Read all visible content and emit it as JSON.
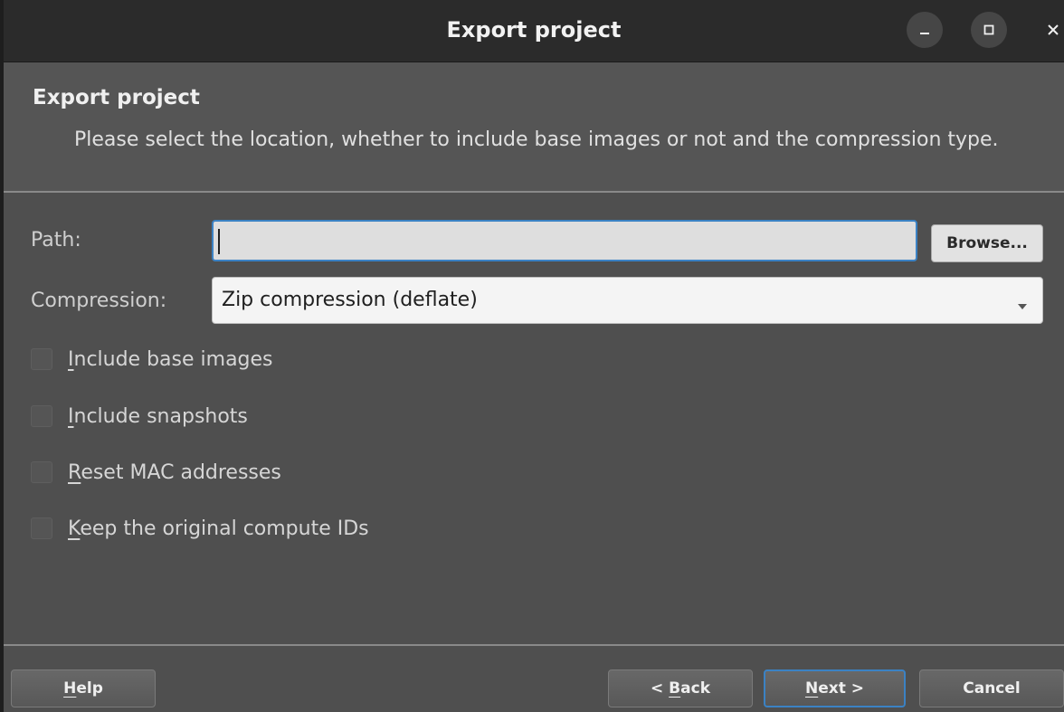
{
  "window": {
    "title": "Export project"
  },
  "header": {
    "title": "Export project",
    "subtitle": "Please select the location, whether to include base images or not and the compression type."
  },
  "form": {
    "path_label": "Path:",
    "path_value": "",
    "browse_label": "Browse...",
    "compression_label": "Compression:",
    "compression_value": "Zip compression (deflate)"
  },
  "options": [
    {
      "mnemonic": "I",
      "rest": "nclude base images",
      "checked": false
    },
    {
      "mnemonic": "I",
      "rest": "nclude snapshots",
      "checked": false
    },
    {
      "mnemonic": "R",
      "rest": "eset MAC addresses",
      "checked": false
    },
    {
      "mnemonic": "K",
      "rest": "eep the original compute IDs",
      "checked": false
    }
  ],
  "footer": {
    "help": {
      "mnemonic": "H",
      "rest": "elp"
    },
    "back": {
      "pre": "< ",
      "mnemonic": "B",
      "rest": "ack"
    },
    "next": {
      "mnemonic": "N",
      "rest": "ext >"
    },
    "cancel": "Cancel"
  },
  "colors": {
    "focus_accent": "#3b82c4",
    "window_bg": "#4f4f4f",
    "titlebar_bg": "#2b2b2b"
  },
  "icons": [
    "minimize-icon",
    "maximize-icon",
    "close-icon",
    "dropdown-arrow-icon"
  ]
}
